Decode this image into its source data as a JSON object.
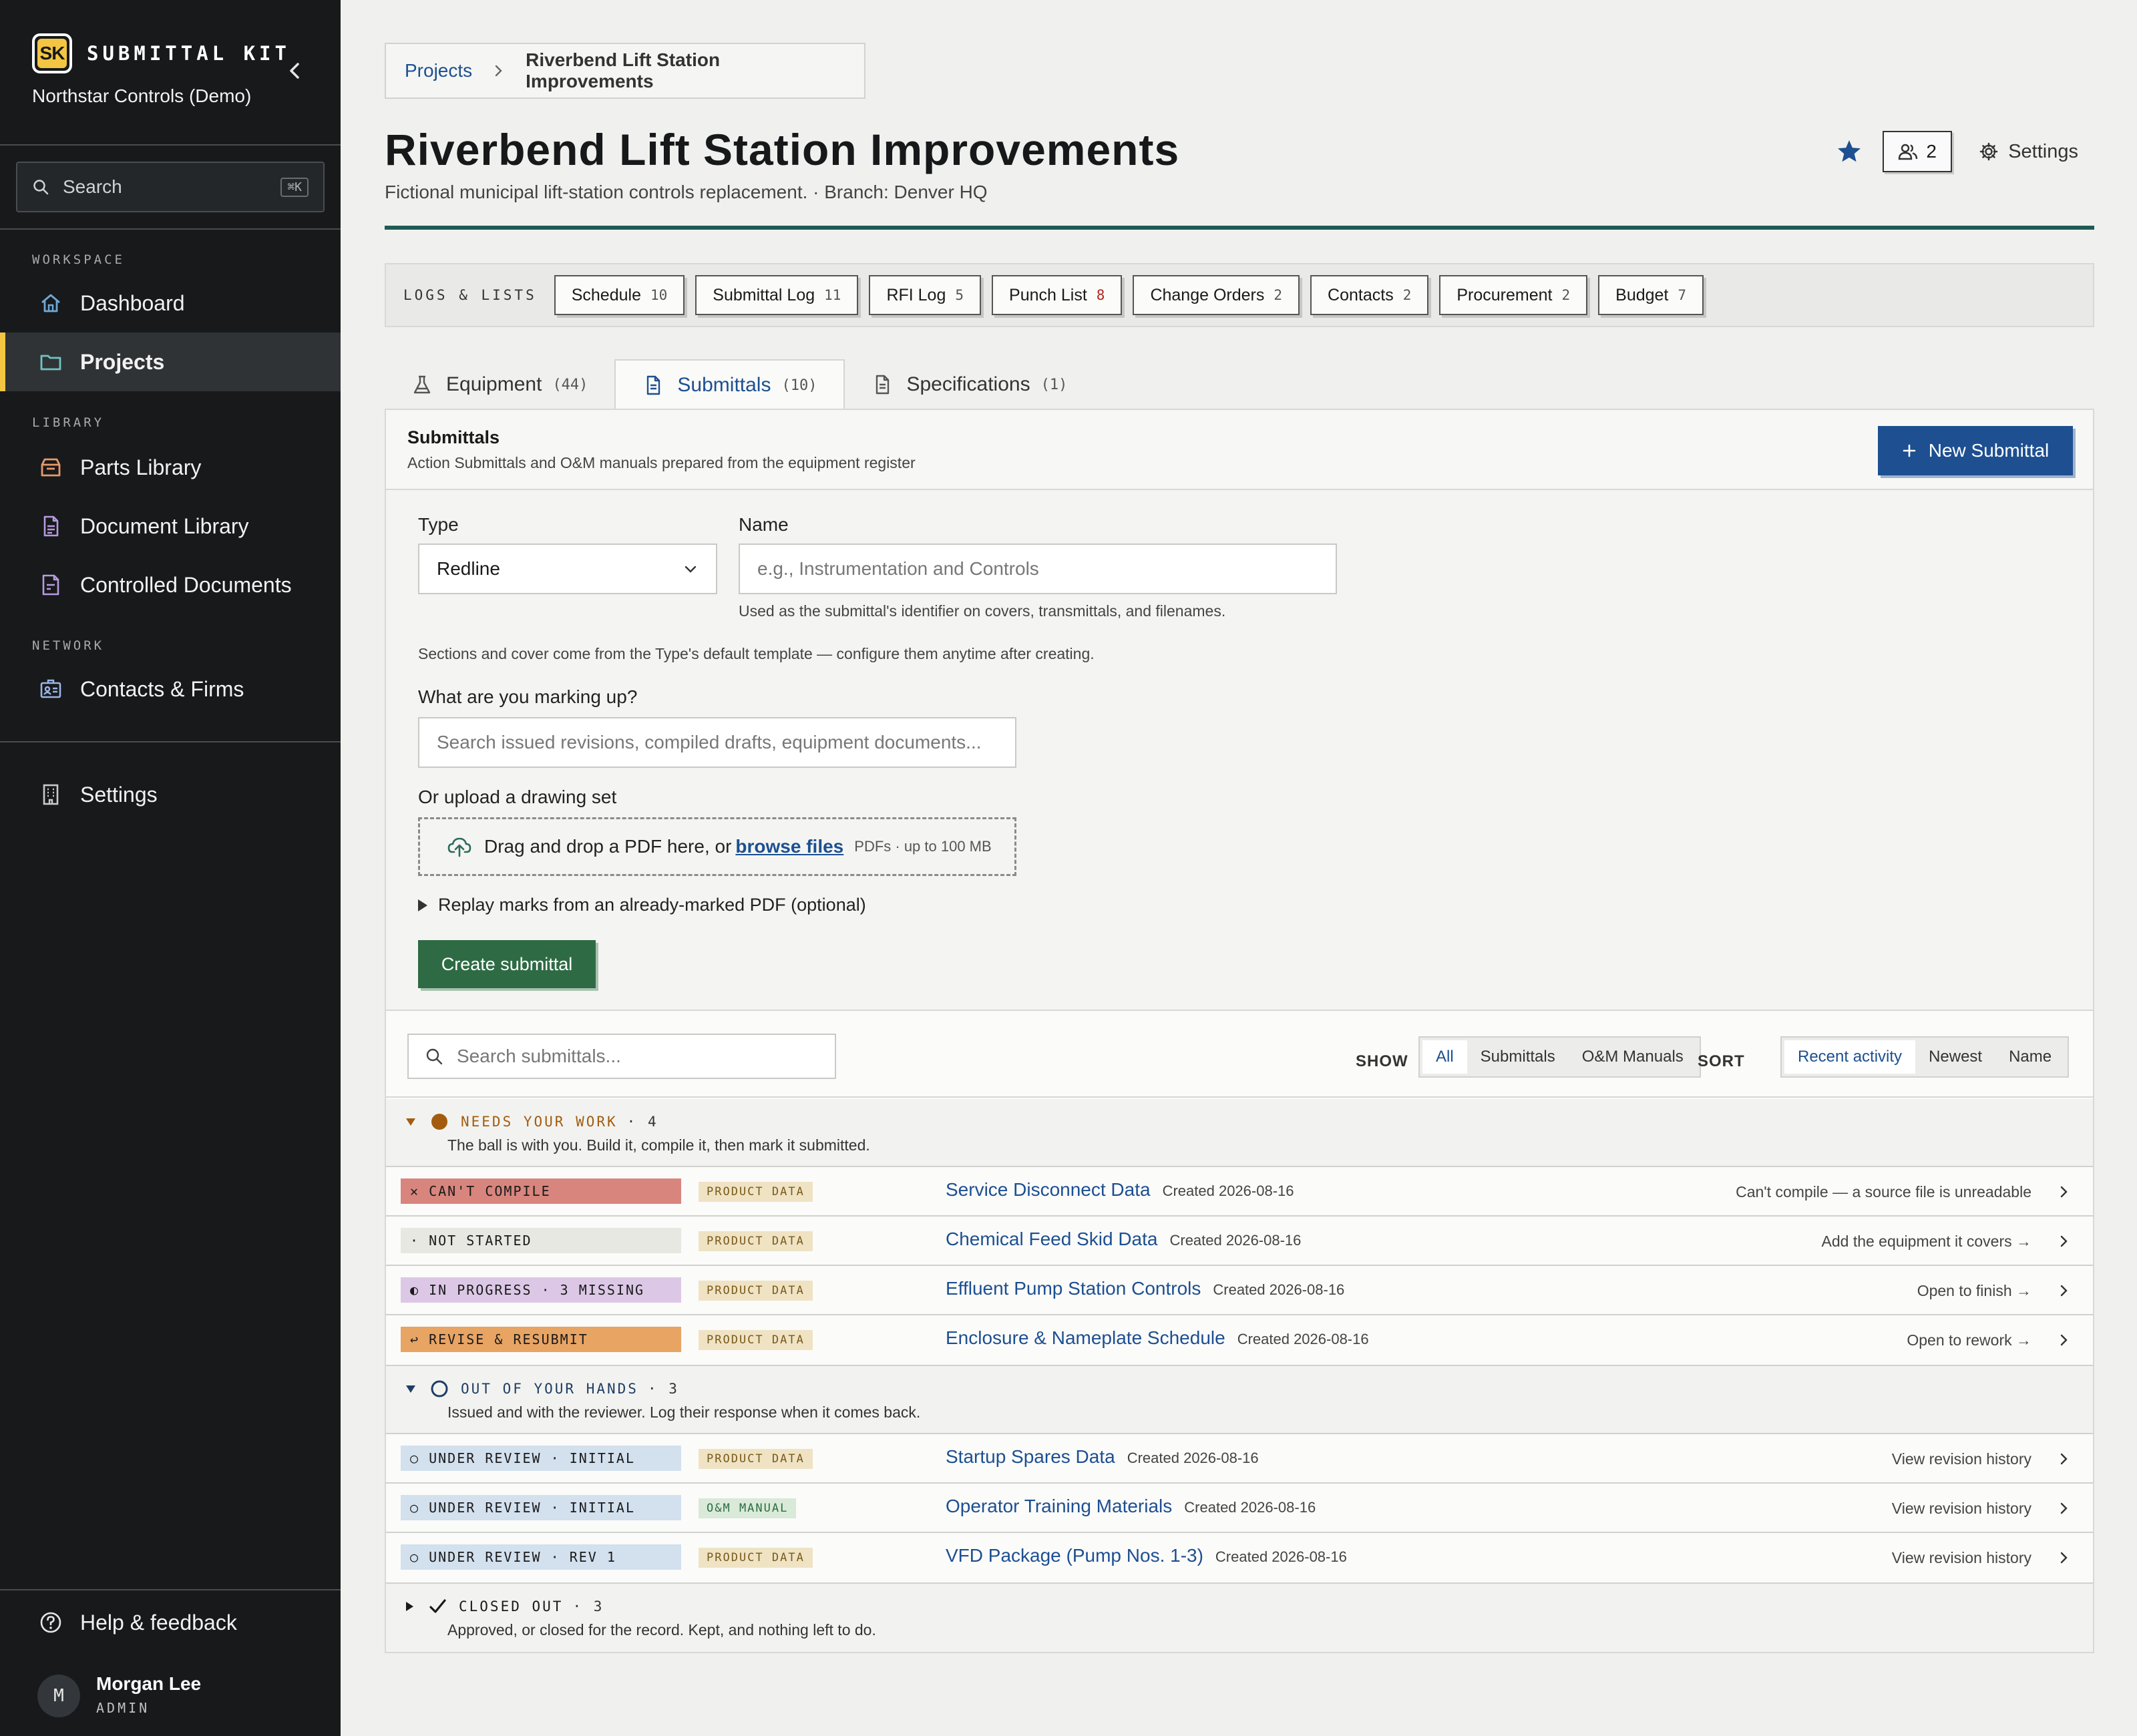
{
  "sidebar": {
    "logo_text": "SK",
    "brand": "SUBMITTAL KIT",
    "org": "Northstar Controls (Demo)",
    "search_placeholder": "Search",
    "search_shortcut": "⌘K",
    "sections": {
      "workspace": "WORKSPACE",
      "library": "LIBRARY",
      "network": "NETWORK"
    },
    "items": {
      "dashboard": "Dashboard",
      "projects": "Projects",
      "parts": "Parts Library",
      "documents": "Document Library",
      "controlled": "Controlled Documents",
      "contacts": "Contacts & Firms",
      "settings": "Settings",
      "help": "Help & feedback"
    },
    "user": {
      "initial": "M",
      "name": "Morgan Lee",
      "role": "ADMIN"
    }
  },
  "breadcrumb": {
    "root": "Projects",
    "current": "Riverbend Lift Station Improvements"
  },
  "header": {
    "title": "Riverbend Lift Station Improvements",
    "subtitle": "Fictional municipal lift-station controls replacement.  ·  Branch: Denver HQ",
    "members_count": "2",
    "settings_label": "Settings"
  },
  "logs": {
    "label": "LOGS & LISTS",
    "items": [
      {
        "label": "Schedule",
        "count": "10"
      },
      {
        "label": "Submittal Log",
        "count": "11"
      },
      {
        "label": "RFI Log",
        "count": "5"
      },
      {
        "label": "Punch List",
        "count": "8"
      },
      {
        "label": "Change Orders",
        "count": "2"
      },
      {
        "label": "Contacts",
        "count": "2"
      },
      {
        "label": "Procurement",
        "count": "2"
      },
      {
        "label": "Budget",
        "count": "7"
      }
    ]
  },
  "tabs": [
    {
      "label": "Equipment",
      "count": "(44)"
    },
    {
      "label": "Submittals",
      "count": "(10)"
    },
    {
      "label": "Specifications",
      "count": "(1)"
    }
  ],
  "panel": {
    "title": "Submittals",
    "description": "Action Submittals and O&M manuals prepared from the equipment register",
    "new_button": "New Submittal"
  },
  "form": {
    "type_label": "Type",
    "type_value": "Redline",
    "name_label": "Name",
    "name_placeholder": "e.g., Instrumentation and Controls",
    "name_hint": "Used as the submittal's identifier on covers, transmittals, and filenames.",
    "sections_note": "Sections and cover come from the Type's default template — configure them anytime after creating.",
    "markup_label": "What are you marking up?",
    "markup_placeholder": "Search issued revisions, compiled drafts, equipment documents...",
    "upload_label": "Or upload a drawing set",
    "drop_text": "Drag and drop a PDF here, or",
    "browse_link": "browse files",
    "drop_note": "PDFs · up to 100 MB",
    "replay_label": "Replay marks from an already-marked PDF (optional)",
    "create_button": "Create submittal"
  },
  "list": {
    "search_placeholder": "Search submittals...",
    "show_label": "SHOW",
    "show_options": [
      "All",
      "Submittals",
      "O&M Manuals"
    ],
    "sort_label": "SORT",
    "sort_options": [
      "Recent activity",
      "Newest",
      "Name"
    ]
  },
  "groups": {
    "needs_work": {
      "title": "NEEDS YOUR WORK",
      "count": "· 4",
      "desc": "The ball is with you. Build it, compile it, then mark it submitted.",
      "color": "#a35c0f"
    },
    "out_of_hands": {
      "title": "OUT OF YOUR HANDS",
      "count": "· 3",
      "desc": "Issued and with the reviewer. Log their response when it comes back.",
      "color": "#1f3d66"
    },
    "closed": {
      "title": "CLOSED OUT",
      "count": "· 3",
      "desc": "Approved, or closed for the record. Kept, and nothing left to do.",
      "color": "#1a1a1a"
    }
  },
  "rows": [
    {
      "status": "✕ CAN'T COMPILE",
      "type": "PRODUCT DATA",
      "name": "Service Disconnect Data",
      "created": "Created 2026-08-16",
      "action": "Can't compile — a source file is unreadable"
    },
    {
      "status": "· NOT STARTED",
      "type": "PRODUCT DATA",
      "name": "Chemical Feed Skid Data",
      "created": "Created 2026-08-16",
      "action": "Add the equipment it covers →"
    },
    {
      "status": "◐ IN PROGRESS · 3 MISSING",
      "type": "PRODUCT DATA",
      "name": "Effluent Pump Station Controls",
      "created": "Created 2026-08-16",
      "action": "Open to finish →"
    },
    {
      "status": "↩ REVISE & RESUBMIT",
      "type": "PRODUCT DATA",
      "name": "Enclosure & Nameplate Schedule",
      "created": "Created 2026-08-16",
      "action": "Open to rework →"
    },
    {
      "status": "○ UNDER REVIEW · INITIAL",
      "type": "PRODUCT DATA",
      "name": "Startup Spares Data",
      "created": "Created 2026-08-16",
      "action": "View revision history"
    },
    {
      "status": "○ UNDER REVIEW · INITIAL",
      "type": "O&M MANUAL",
      "name": "Operator Training Materials",
      "created": "Created 2026-08-16",
      "action": "View revision history"
    },
    {
      "status": "○ UNDER REVIEW · REV 1",
      "type": "PRODUCT DATA",
      "name": "VFD Package (Pump Nos. 1-3)",
      "created": "Created 2026-08-16",
      "action": "View revision history"
    }
  ],
  "colors": {
    "accent": "#1d4f91",
    "create": "#2e6b45",
    "cant_compile": "#d8857d",
    "not_started": "#e6e8e1",
    "in_progress": "#dcc8e6",
    "revise": "#e8a463",
    "under_review": "#d3e0ee",
    "product_data": "#efe3c4",
    "om_manual": "#d9ead8"
  }
}
